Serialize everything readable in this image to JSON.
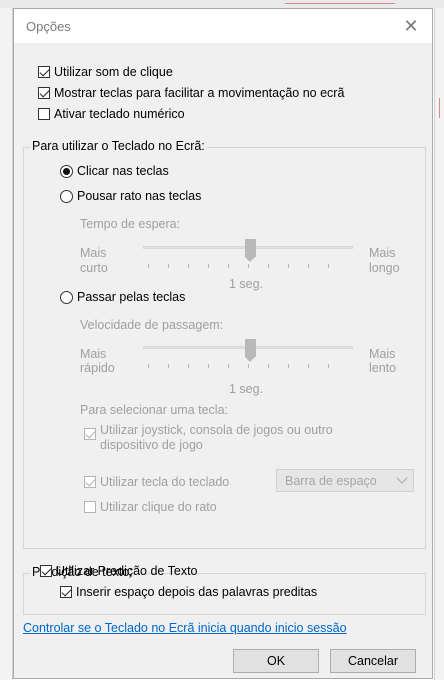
{
  "dialog": {
    "title": "Opções",
    "close_glyph": "✕"
  },
  "options": {
    "click_sound": {
      "label": "Utilizar som de clique",
      "checked": true
    },
    "show_keys": {
      "label": "Mostrar teclas para facilitar a movimentação no ecrã",
      "checked": true
    },
    "numpad": {
      "label": "Ativar teclado numérico",
      "checked": false
    }
  },
  "usage_group": {
    "label": "Para utilizar o Teclado no Ecrã:",
    "click_keys": {
      "label": "Clicar nas teclas",
      "selected": true
    },
    "hover_keys": {
      "label": "Pousar rato nas teclas",
      "selected": false
    },
    "hover_time": {
      "label": "Tempo de espera:",
      "min_label_1": "Mais",
      "min_label_2": "curto",
      "max_label_1": "Mais",
      "max_label_2": "longo",
      "value_label": "1 seg."
    },
    "scan_keys": {
      "label": "Passar pelas teclas",
      "selected": false
    },
    "scan_speed": {
      "label": "Velocidade de passagem:",
      "min_label_1": "Mais",
      "min_label_2": "rápido",
      "max_label_1": "Mais",
      "max_label_2": "lento",
      "value_label": "1 seg."
    },
    "select_key_label": "Para selecionar uma tecla:",
    "joystick": {
      "label_1": "Utilizar joystick, consola de jogos ou outro",
      "label_2": "dispositivo de jogo",
      "checked": true
    },
    "keyboard_key": {
      "label": "Utilizar tecla do teclado",
      "checked": true
    },
    "key_select": {
      "value": "Barra de espaço"
    },
    "mouse_click": {
      "label": "Utilizar clique do rato",
      "checked": false
    }
  },
  "prediction_group": {
    "label": "Predição de texto:",
    "use_prediction": {
      "label": "Utilizar Predição de Texto",
      "checked": true
    },
    "insert_space": {
      "label": "Inserir espaço depois das palavras preditas",
      "checked": true
    }
  },
  "startup_link": "Controlar se o Teclado no Ecrã inicia quando inicio sessão",
  "buttons": {
    "ok": "OK",
    "cancel": "Cancelar"
  },
  "colors": {
    "link": "#0066cc",
    "dialog_bg": "#f0f0f0",
    "disabled_text": "#a0a0a0"
  }
}
